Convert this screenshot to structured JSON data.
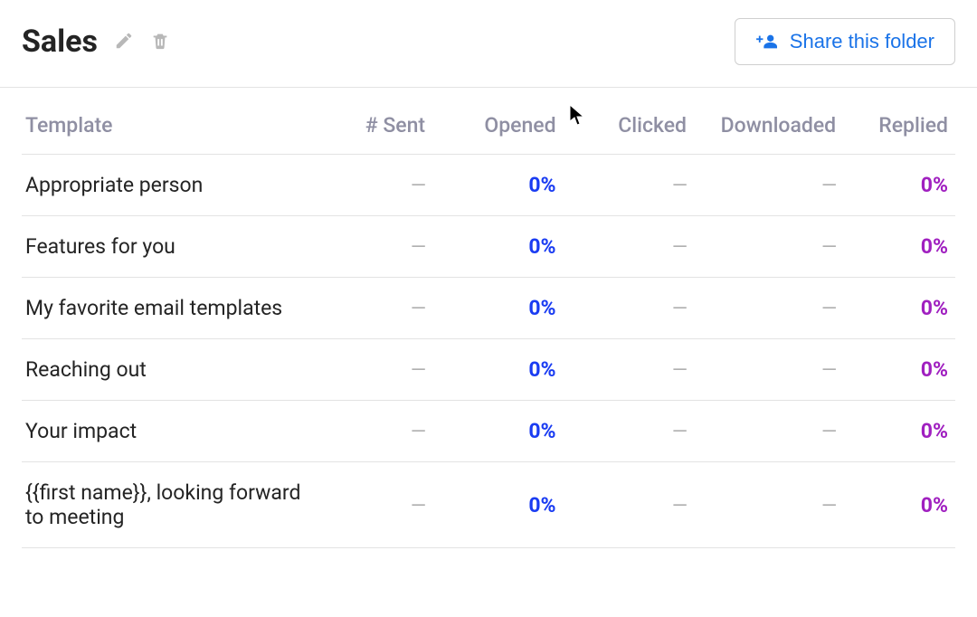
{
  "header": {
    "title": "Sales",
    "share_label": "Share this folder"
  },
  "table": {
    "columns": {
      "template": "Template",
      "sent": "# Sent",
      "opened": "Opened",
      "clicked": "Clicked",
      "downloaded": "Downloaded",
      "replied": "Replied"
    },
    "rows": [
      {
        "template": "Appropriate person",
        "sent": "—",
        "opened": "0%",
        "clicked": "—",
        "downloaded": "—",
        "replied": "0%"
      },
      {
        "template": "Features for you",
        "sent": "—",
        "opened": "0%",
        "clicked": "—",
        "downloaded": "—",
        "replied": "0%"
      },
      {
        "template": "My favorite email templates",
        "sent": "—",
        "opened": "0%",
        "clicked": "—",
        "downloaded": "—",
        "replied": "0%"
      },
      {
        "template": "Reaching out",
        "sent": "—",
        "opened": "0%",
        "clicked": "—",
        "downloaded": "—",
        "replied": "0%"
      },
      {
        "template": "Your impact",
        "sent": "—",
        "opened": "0%",
        "clicked": "—",
        "downloaded": "—",
        "replied": "0%"
      },
      {
        "template": "{{first name}}, looking forward to meeting",
        "sent": "—",
        "opened": "0%",
        "clicked": "—",
        "downloaded": "—",
        "replied": "0%"
      }
    ]
  }
}
